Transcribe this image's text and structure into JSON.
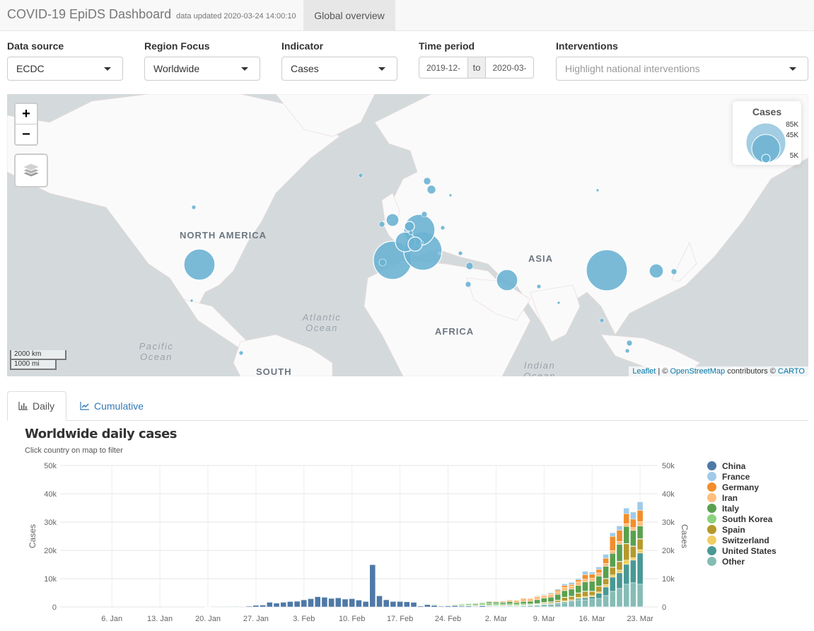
{
  "header": {
    "title": "COVID-19 EpiDS Dashboard",
    "updated": "data updated 2020-03-24 14:00:10",
    "nav_tab": "Global overview"
  },
  "controls": {
    "data_source": {
      "label": "Data source",
      "value": "ECDC"
    },
    "region_focus": {
      "label": "Region Focus",
      "value": "Worldwide"
    },
    "indicator": {
      "label": "Indicator",
      "value": "Cases"
    },
    "time_period": {
      "label": "Time period",
      "start": "2019-12-",
      "separator": "to",
      "end": "2020-03-"
    },
    "interventions": {
      "label": "Interventions",
      "placeholder": "Highlight national interventions"
    }
  },
  "map": {
    "zoom_in": "+",
    "zoom_out": "−",
    "layers_icon": "layers-icon",
    "legend_title": "Cases",
    "legend_values": [
      "85K",
      "45K",
      "5K"
    ],
    "scale_km": "2000 km",
    "scale_mi": "1000 mi",
    "labels": {
      "north_america": "NORTH AMERICA",
      "south": "SOUTH",
      "africa": "AFRICA",
      "asia": "ASIA",
      "atlantic": "Atlantic Ocean",
      "pacific": "Pacific Ocean",
      "indian": "Indian Ocean"
    },
    "attribution": {
      "leaflet": "Leaflet",
      "sep": " | © ",
      "osm": "OpenStreetMap",
      "contrib": " contributors © ",
      "carto": "CARTO"
    },
    "bubble_color": "#6bb3d3"
  },
  "tabs": [
    {
      "label": "Daily",
      "icon": "bar-chart-icon",
      "active": true
    },
    {
      "label": "Cumulative",
      "icon": "line-chart-icon",
      "active": false
    }
  ],
  "chart_data": {
    "type": "bar",
    "stacked": true,
    "title": "Worldwide daily cases",
    "subtitle": "Click country on map to filter",
    "ylabel": "Cases",
    "ylabel_right": "Cases",
    "ylim": [
      0,
      50000
    ],
    "yticks": [
      "0",
      "10k",
      "20k",
      "30k",
      "40k",
      "50k"
    ],
    "x_start": "2019-12-31",
    "x_end": "2020-03-24",
    "xticks": [
      "6. Jan",
      "13. Jan",
      "20. Jan",
      "27. Jan",
      "3. Feb",
      "10. Feb",
      "17. Feb",
      "24. Feb",
      "2. Mar",
      "9. Mar",
      "16. Mar",
      "23. Mar"
    ],
    "xtick_day_index": [
      6,
      13,
      20,
      27,
      34,
      41,
      48,
      55,
      62,
      69,
      76,
      83
    ],
    "legend_position": "right",
    "series": [
      {
        "name": "China",
        "color": "#4e79a7"
      },
      {
        "name": "France",
        "color": "#a0cbe8"
      },
      {
        "name": "Germany",
        "color": "#f28e2b"
      },
      {
        "name": "Iran",
        "color": "#ffbe7d"
      },
      {
        "name": "Italy",
        "color": "#59a14f"
      },
      {
        "name": "South Korea",
        "color": "#8cd17d"
      },
      {
        "name": "Spain",
        "color": "#b6992d"
      },
      {
        "name": "Switzerland",
        "color": "#f1ce63"
      },
      {
        "name": "United States",
        "color": "#499894"
      },
      {
        "name": "Other",
        "color": "#86bcb6"
      }
    ],
    "days": [
      [
        0,
        0,
        0,
        0,
        0,
        0,
        0,
        0,
        0,
        0
      ],
      [
        0,
        0,
        0,
        0,
        0,
        0,
        0,
        0,
        0,
        0
      ],
      [
        0,
        0,
        0,
        0,
        0,
        0,
        0,
        0,
        0,
        0
      ],
      [
        0,
        0,
        0,
        0,
        0,
        0,
        0,
        0,
        0,
        0
      ],
      [
        0,
        0,
        0,
        0,
        0,
        0,
        0,
        0,
        0,
        0
      ],
      [
        0,
        0,
        0,
        0,
        0,
        0,
        0,
        0,
        0,
        0
      ],
      [
        0,
        0,
        0,
        0,
        0,
        0,
        0,
        0,
        0,
        0
      ],
      [
        0,
        0,
        0,
        0,
        0,
        0,
        0,
        0,
        0,
        0
      ],
      [
        0,
        0,
        0,
        0,
        0,
        0,
        0,
        0,
        0,
        0
      ],
      [
        0,
        0,
        0,
        0,
        0,
        0,
        0,
        0,
        0,
        0
      ],
      [
        0,
        0,
        0,
        0,
        0,
        0,
        0,
        0,
        0,
        0
      ],
      [
        0,
        0,
        0,
        0,
        0,
        0,
        0,
        0,
        0,
        0
      ],
      [
        0,
        0,
        0,
        0,
        0,
        0,
        0,
        0,
        0,
        0
      ],
      [
        0,
        0,
        0,
        0,
        0,
        0,
        0,
        0,
        0,
        0
      ],
      [
        0,
        0,
        0,
        0,
        0,
        0,
        0,
        0,
        0,
        0
      ],
      [
        0,
        0,
        0,
        0,
        0,
        0,
        0,
        0,
        0,
        0
      ],
      [
        0,
        0,
        0,
        0,
        0,
        0,
        0,
        0,
        0,
        0
      ],
      [
        0,
        0,
        0,
        0,
        0,
        0,
        0,
        0,
        0,
        0
      ],
      [
        0,
        0,
        0,
        0,
        0,
        0,
        0,
        0,
        0,
        0
      ],
      [
        0,
        0,
        0,
        0,
        0,
        0,
        0,
        0,
        0,
        0
      ],
      [
        80,
        0,
        0,
        0,
        0,
        0,
        0,
        0,
        0,
        0
      ],
      [
        150,
        0,
        0,
        0,
        0,
        0,
        0,
        0,
        0,
        0
      ],
      [
        0,
        0,
        0,
        0,
        0,
        0,
        0,
        0,
        0,
        0
      ],
      [
        250,
        0,
        0,
        0,
        0,
        0,
        0,
        0,
        0,
        10
      ],
      [
        260,
        0,
        0,
        0,
        0,
        0,
        0,
        0,
        0,
        10
      ],
      [
        0,
        0,
        0,
        0,
        0,
        0,
        0,
        0,
        0,
        0
      ],
      [
        400,
        0,
        0,
        0,
        0,
        0,
        0,
        0,
        0,
        20
      ],
      [
        700,
        0,
        0,
        0,
        0,
        0,
        0,
        0,
        0,
        20
      ],
      [
        780,
        0,
        0,
        0,
        0,
        0,
        0,
        0,
        0,
        20
      ],
      [
        1750,
        0,
        0,
        0,
        0,
        0,
        0,
        0,
        0,
        30
      ],
      [
        1450,
        0,
        0,
        0,
        0,
        0,
        0,
        0,
        0,
        30
      ],
      [
        1750,
        0,
        0,
        0,
        0,
        0,
        0,
        0,
        0,
        30
      ],
      [
        2000,
        0,
        0,
        0,
        0,
        0,
        0,
        0,
        0,
        40
      ],
      [
        2100,
        0,
        0,
        0,
        0,
        0,
        0,
        0,
        0,
        40
      ],
      [
        2600,
        0,
        0,
        0,
        0,
        0,
        0,
        0,
        0,
        40
      ],
      [
        3000,
        0,
        0,
        0,
        0,
        0,
        0,
        0,
        0,
        50
      ],
      [
        3700,
        0,
        0,
        0,
        0,
        0,
        0,
        0,
        0,
        50
      ],
      [
        3500,
        0,
        0,
        0,
        0,
        0,
        0,
        0,
        0,
        50
      ],
      [
        3100,
        0,
        0,
        0,
        0,
        0,
        0,
        0,
        0,
        50
      ],
      [
        3300,
        0,
        0,
        0,
        0,
        0,
        0,
        0,
        0,
        60
      ],
      [
        2850,
        0,
        0,
        0,
        0,
        0,
        0,
        0,
        0,
        60
      ],
      [
        3000,
        0,
        0,
        0,
        0,
        0,
        0,
        0,
        0,
        60
      ],
      [
        2500,
        0,
        0,
        0,
        0,
        0,
        0,
        0,
        0,
        60
      ],
      [
        2000,
        0,
        0,
        0,
        0,
        0,
        0,
        0,
        0,
        60
      ],
      [
        15000,
        0,
        0,
        0,
        0,
        0,
        0,
        0,
        0,
        60
      ],
      [
        4000,
        0,
        0,
        0,
        0,
        0,
        0,
        0,
        0,
        60
      ],
      [
        2600,
        0,
        0,
        0,
        0,
        0,
        0,
        0,
        0,
        60
      ],
      [
        2000,
        0,
        0,
        0,
        0,
        0,
        0,
        0,
        0,
        60
      ],
      [
        2000,
        0,
        0,
        0,
        0,
        0,
        0,
        0,
        0,
        60
      ],
      [
        1900,
        0,
        0,
        0,
        0,
        0,
        0,
        0,
        0,
        60
      ],
      [
        1700,
        0,
        0,
        0,
        0,
        0,
        0,
        0,
        0,
        60
      ],
      [
        400,
        0,
        0,
        0,
        0,
        0,
        0,
        0,
        0,
        60
      ],
      [
        900,
        0,
        0,
        0,
        0,
        80,
        0,
        0,
        0,
        60
      ],
      [
        600,
        0,
        0,
        0,
        20,
        300,
        0,
        0,
        0,
        100
      ],
      [
        300,
        0,
        0,
        10,
        70,
        200,
        0,
        0,
        0,
        100
      ],
      [
        400,
        0,
        0,
        20,
        100,
        170,
        0,
        0,
        0,
        100
      ],
      [
        450,
        0,
        0,
        20,
        80,
        300,
        0,
        0,
        0,
        150
      ],
      [
        300,
        0,
        0,
        40,
        200,
        450,
        0,
        0,
        0,
        150
      ],
      [
        320,
        20,
        20,
        110,
        250,
        500,
        10,
        0,
        10,
        200
      ],
      [
        200,
        30,
        50,
        150,
        200,
        600,
        20,
        10,
        15,
        250
      ],
      [
        420,
        40,
        50,
        210,
        240,
        570,
        30,
        10,
        15,
        250
      ],
      [
        200,
        60,
        50,
        300,
        460,
        800,
        30,
        10,
        20,
        300
      ],
      [
        150,
        30,
        50,
        350,
        550,
        600,
        20,
        10,
        20,
        350
      ],
      [
        120,
        40,
        50,
        500,
        600,
        500,
        30,
        20,
        20,
        350
      ],
      [
        150,
        60,
        60,
        600,
        800,
        440,
        50,
        20,
        30,
        400
      ],
      [
        70,
        80,
        80,
        800,
        550,
        500,
        50,
        30,
        60,
        300
      ],
      [
        50,
        100,
        100,
        1200,
        800,
        400,
        80,
        40,
        80,
        450
      ],
      [
        40,
        150,
        120,
        1000,
        900,
        300,
        100,
        60,
        100,
        500
      ],
      [
        30,
        200,
        150,
        1200,
        1300,
        250,
        150,
        90,
        120,
        600
      ],
      [
        40,
        250,
        200,
        900,
        1500,
        250,
        300,
        100,
        150,
        800
      ],
      [
        30,
        300,
        300,
        1000,
        1600,
        150,
        400,
        150,
        200,
        900
      ],
      [
        25,
        400,
        500,
        1000,
        2000,
        110,
        600,
        200,
        300,
        1200
      ],
      [
        20,
        600,
        600,
        1200,
        2300,
        100,
        1200,
        300,
        350,
        1500
      ],
      [
        20,
        800,
        500,
        1100,
        2500,
        80,
        1200,
        300,
        400,
        1800
      ],
      [
        15,
        500,
        700,
        1300,
        2600,
        70,
        1500,
        400,
        500,
        2500
      ],
      [
        20,
        1200,
        1600,
        1000,
        3200,
        90,
        1800,
        500,
        700,
        2500
      ],
      [
        15,
        800,
        1400,
        1100,
        3500,
        90,
        1400,
        450,
        800,
        2800
      ],
      [
        20,
        900,
        1200,
        1150,
        3500,
        80,
        2000,
        500,
        1800,
        3000
      ],
      [
        25,
        1400,
        1800,
        1100,
        4200,
        90,
        2100,
        900,
        3000,
        4000
      ],
      [
        30,
        1300,
        5000,
        1000,
        4800,
        100,
        2700,
        800,
        5000,
        5500
      ],
      [
        40,
        1500,
        4000,
        1000,
        6000,
        100,
        3000,
        1000,
        5500,
        6500
      ],
      [
        45,
        2000,
        3500,
        1000,
        6000,
        100,
        5800,
        1500,
        7000,
        8000
      ],
      [
        40,
        2500,
        3000,
        1000,
        5500,
        100,
        4000,
        900,
        8000,
        8500
      ],
      [
        45,
        3000,
        4000,
        1500,
        4500,
        100,
        3800,
        1200,
        11000,
        8000
      ]
    ]
  }
}
